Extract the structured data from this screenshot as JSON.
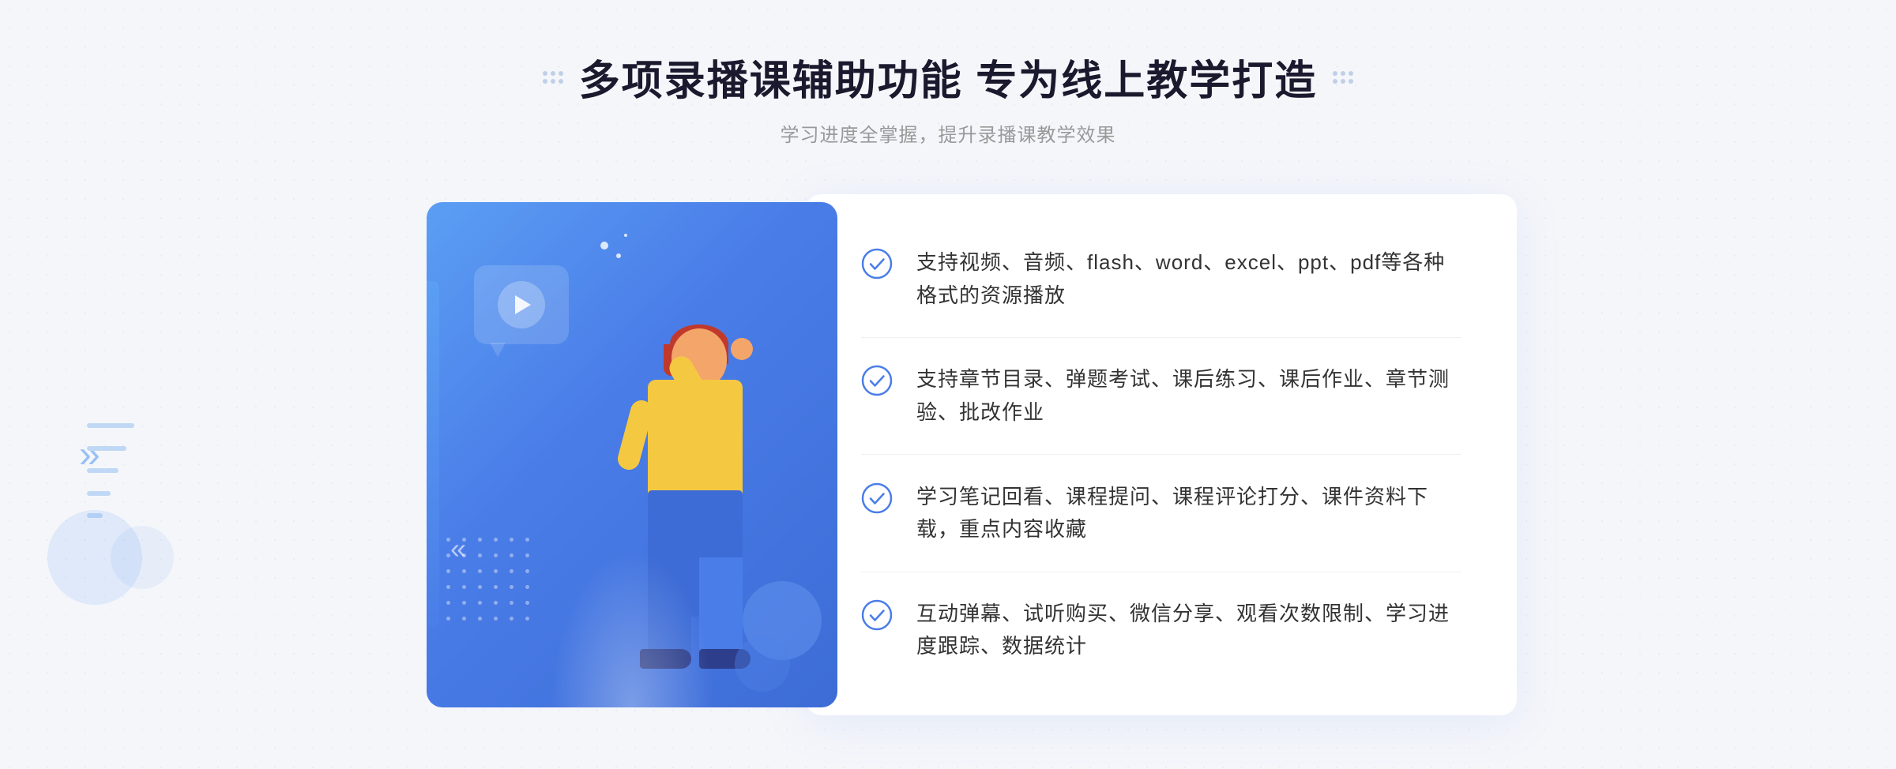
{
  "header": {
    "title": "多项录播课辅助功能 专为线上教学打造",
    "subtitle": "学习进度全掌握，提升录播课教学效果",
    "deco_dots_left": "···",
    "deco_dots_right": "···"
  },
  "features": [
    {
      "id": "feature-1",
      "text": "支持视频、音频、flash、word、excel、ppt、pdf等各种格式的资源播放"
    },
    {
      "id": "feature-2",
      "text": "支持章节目录、弹题考试、课后练习、课后作业、章节测验、批改作业"
    },
    {
      "id": "feature-3",
      "text": "学习笔记回看、课程提问、课程评论打分、课件资料下载，重点内容收藏"
    },
    {
      "id": "feature-4",
      "text": "互动弹幕、试听购买、微信分享、观看次数限制、学习进度跟踪、数据统计"
    }
  ],
  "colors": {
    "primary": "#4a7de8",
    "check_color": "#4a7de8",
    "title_color": "#1a1a2e",
    "text_color": "#333333",
    "sub_text": "#999999"
  },
  "icons": {
    "check": "check-circle-icon",
    "play": "play-icon",
    "arrow_left": "»"
  }
}
